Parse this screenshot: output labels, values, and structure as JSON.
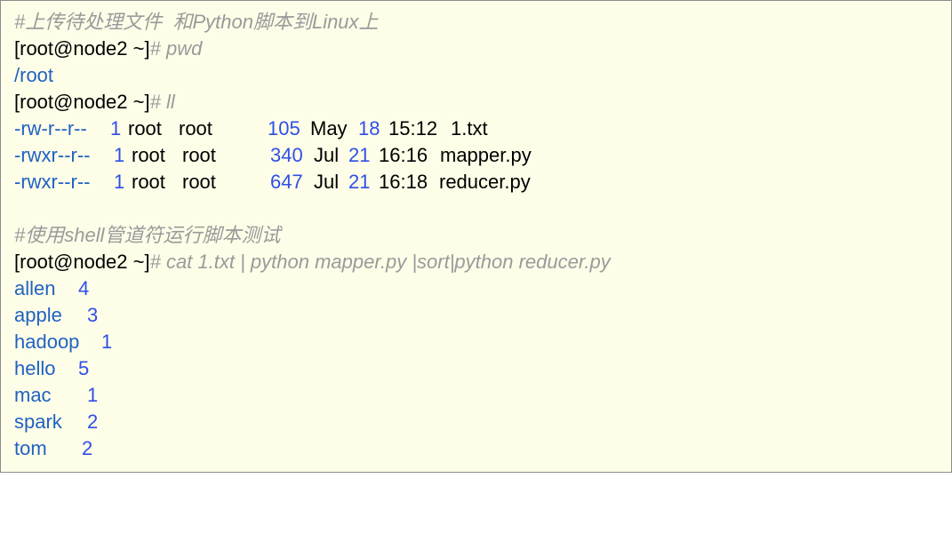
{
  "colors": {
    "background": "#fefde8",
    "border": "#8c8c8c",
    "comment": "#9a9a9a",
    "output_blue": "#1f62c3",
    "number_blue": "#2f4fe6",
    "text": "#000000"
  },
  "lines": {
    "comment1": "#上传待处理文件  和Python脚本到Linux上",
    "prompt": "[root@node2 ~]",
    "cmd_pwd": "# pwd",
    "pwd_output": "/root",
    "cmd_ll": "# ll",
    "comment2": "#使用shell管道符运行脚本测试",
    "cmd_pipe": "# cat 1.txt | python mapper.py |sort|python reducer.py"
  },
  "files": [
    {
      "perms": "-rw-r--r--",
      "links": "1",
      "owner": "root",
      "group": "root",
      "size": "105",
      "month": "May",
      "day": "18",
      "time": "15:12",
      "name": "1.txt"
    },
    {
      "perms": "-rwxr--r--",
      "links": "1",
      "owner": "root",
      "group": "root",
      "size": "340",
      "month": "Jul",
      "day": "21",
      "time": "16:16",
      "name": "mapper.py"
    },
    {
      "perms": "-rwxr--r--",
      "links": "1",
      "owner": "root",
      "group": "root",
      "size": "647",
      "month": "Jul",
      "day": "21",
      "time": "16:18",
      "name": "reducer.py"
    }
  ],
  "word_counts": [
    {
      "word": "allen",
      "count": "4"
    },
    {
      "word": "apple",
      "count": "3"
    },
    {
      "word": "hadoop",
      "count": "1"
    },
    {
      "word": "hello",
      "count": "5"
    },
    {
      "word": "mac",
      "count": "1"
    },
    {
      "word": "spark",
      "count": "2"
    },
    {
      "word": "tom",
      "count": "2"
    }
  ]
}
